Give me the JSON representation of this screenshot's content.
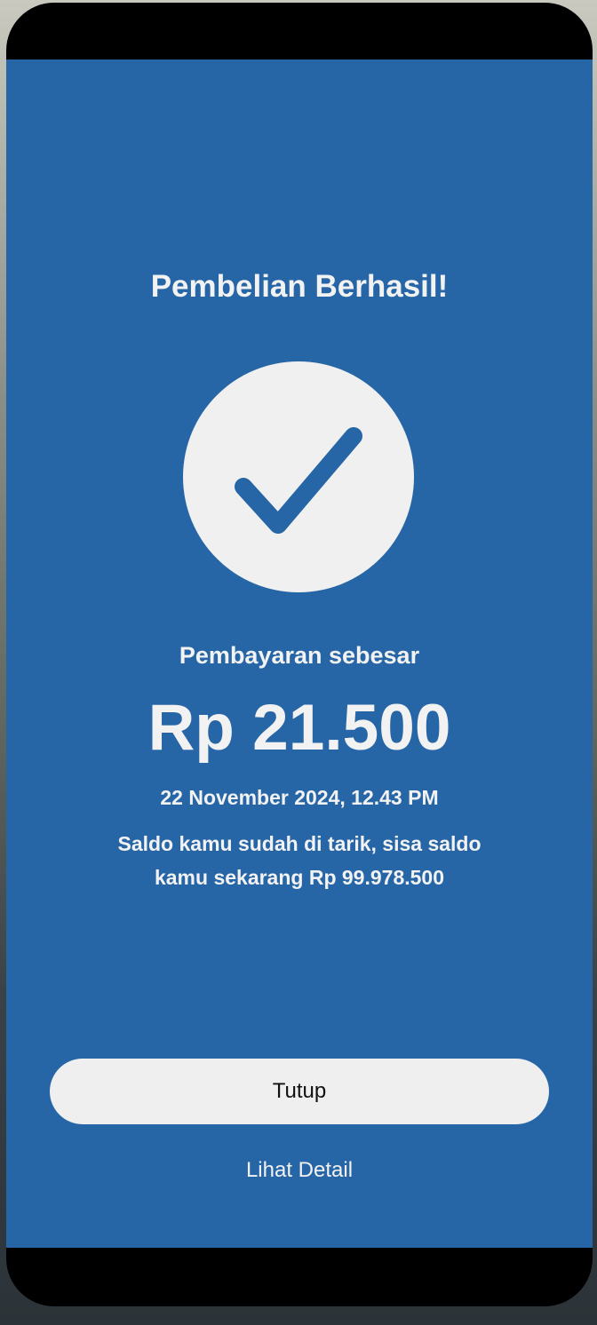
{
  "colors": {
    "screen_background": "#2766a6",
    "text": "#f2f2f2",
    "button_background": "#efefef",
    "check_circle": "#f0f0f0",
    "check_mark": "#2766a6"
  },
  "success": {
    "title": "Pembelian Berhasil!",
    "icon": "checkmark-circle-icon",
    "payment_label": "Pembayaran sebesar",
    "amount": "Rp 21.500",
    "datetime": "22 November 2024, 12.43 PM",
    "balance_note": "Saldo kamu sudah di tarik, sisa saldo kamu sekarang Rp 99.978.500"
  },
  "actions": {
    "close_label": "Tutup",
    "detail_label": "Lihat Detail"
  }
}
